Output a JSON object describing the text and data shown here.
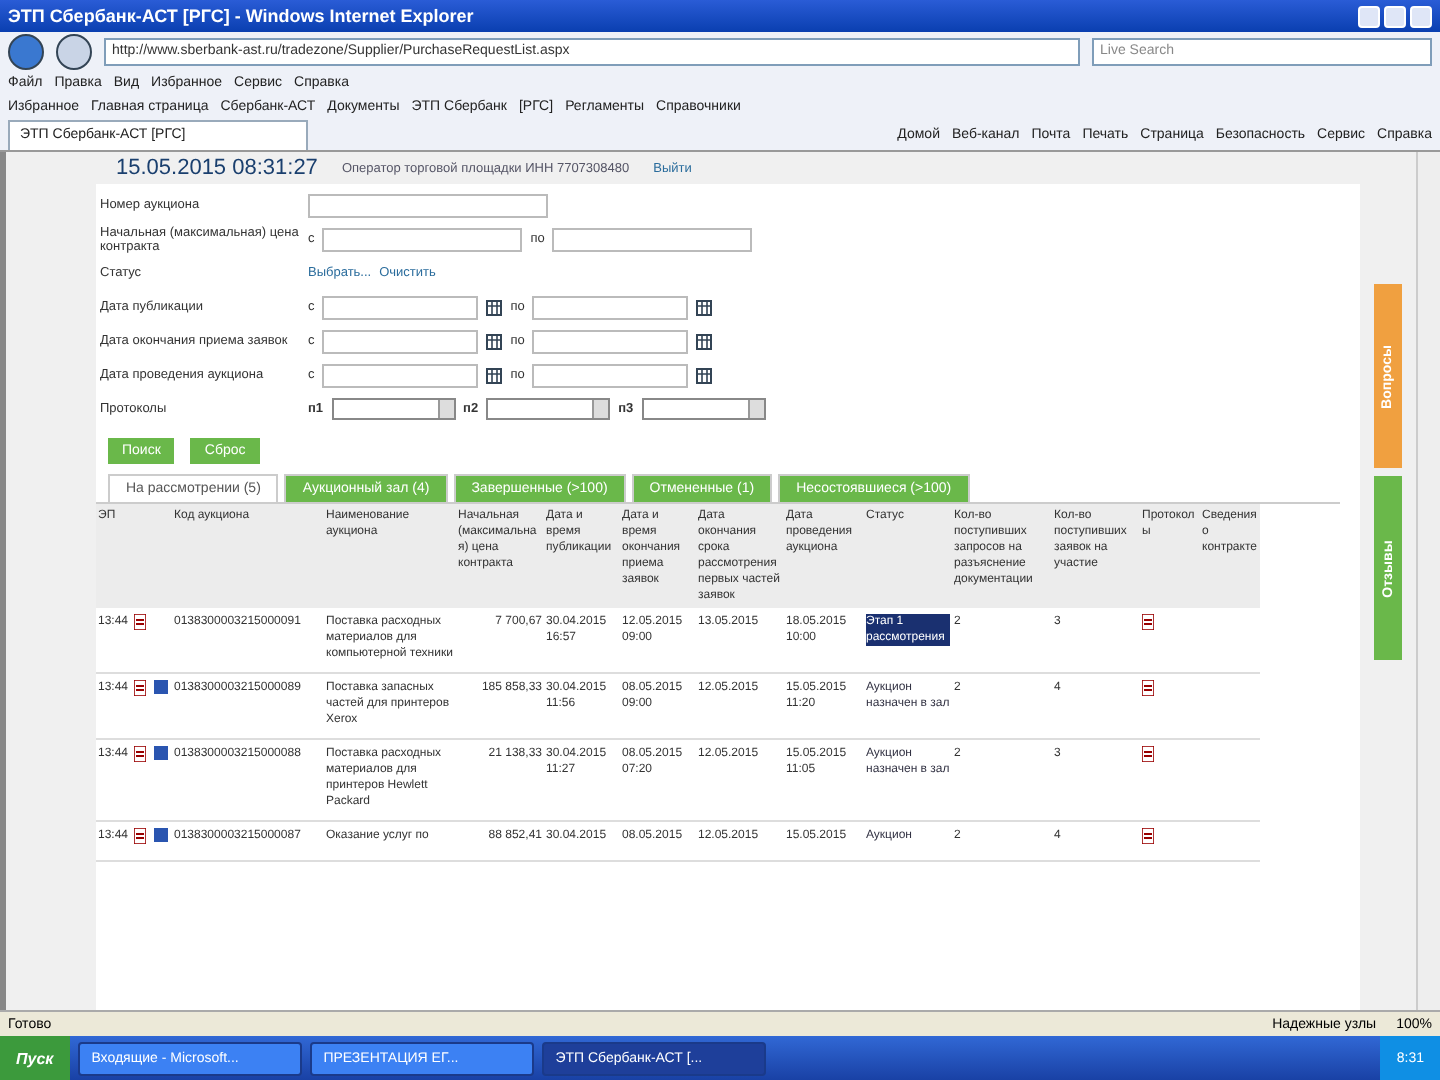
{
  "window": {
    "title": "ЭТП Сбербанк-АСТ [РГС] - Windows Internet Explorer"
  },
  "address": {
    "url": "http://www.sberbank-ast.ru/tradezone/Supplier/PurchaseRequestList.aspx",
    "search_placeholder": "Live Search"
  },
  "menu": [
    "Файл",
    "Правка",
    "Вид",
    "Избранное",
    "Сервис",
    "Справка"
  ],
  "favorites": [
    "Избранное",
    "Главная страница",
    "Сбербанк-АСТ",
    "Документы",
    "ЭТП Сбербанк",
    "[РГС]",
    "Регламенты",
    "Справочники"
  ],
  "browser_tab": {
    "title": "ЭТП Сбербанк-АСТ [РГС]"
  },
  "commands": [
    "Домой",
    "Веб-канал",
    "Почта",
    "Печать",
    "Страница",
    "Безопасность",
    "Сервис",
    "Справка"
  ],
  "header": {
    "datetime": "15.05.2015 08:31:27",
    "user": "Оператор торговой площадки ИНН 7707308480",
    "logout": "Выйти"
  },
  "filters": [
    {
      "kind": "text",
      "label": "Номер аукциона"
    },
    {
      "kind": "range",
      "label": "Начальная (максимальная) цена контракта",
      "from": "с",
      "to": "по"
    },
    {
      "kind": "links",
      "label": "Статус",
      "links": [
        "Выбрать...",
        "Очистить"
      ]
    },
    {
      "kind": "date",
      "label": "Дата публикации",
      "from": "с",
      "to": "по"
    },
    {
      "kind": "date",
      "label": "Дата окончания приема заявок",
      "from": "с",
      "to": "по"
    },
    {
      "kind": "date",
      "label": "Дата проведения аукциона",
      "from": "с",
      "to": "по"
    },
    {
      "kind": "protocols",
      "label": "Протоколы",
      "selects": [
        "п1",
        "п2",
        "п3"
      ]
    }
  ],
  "buttons": [
    "Поиск",
    "Сброс"
  ],
  "tabs": [
    {
      "label": "На рассмотрении (5)",
      "selected": true
    },
    {
      "label": "Аукционный зал (4)",
      "selected": false
    },
    {
      "label": "Завершенные (>100)",
      "selected": false
    },
    {
      "label": "Отмененные (1)",
      "selected": false
    },
    {
      "label": "Несостоявшиеся (>100)",
      "selected": false
    }
  ],
  "table": {
    "columns": [
      "ЭП",
      "Код аукциона",
      "Наименование аукциона",
      "Начальная (максимальная) цена контракта",
      "Дата и время публикации",
      "Дата и время окончания приема заявок",
      "Дата окончания срока рассмотрения первых частей заявок",
      "Дата проведения аукциона",
      "Статус",
      "Кол-во поступивших запросов на разъяснение документации",
      "Кол-во поступивших заявок на участие",
      "Протоколы",
      "Сведения о контракте"
    ],
    "rows": [
      {
        "time": "13:44",
        "info": false,
        "code": "0138300003215000091",
        "name": "Поставка расходных материалов для компьютерной техники",
        "price": "7 700,67",
        "published": "30.04.2015 16:57",
        "apps_end": "12.05.2015 09:00",
        "review_end": "13.05.2015",
        "auction": "18.05.2015 10:00",
        "status": "Этап 1 рассмотрения",
        "status_selected": true,
        "requests": "2",
        "apps": "3"
      },
      {
        "time": "13:44",
        "info": true,
        "code": "0138300003215000089",
        "name": "Поставка запасных частей для принтеров Xerox",
        "price": "185 858,33",
        "published": "30.04.2015 11:56",
        "apps_end": "08.05.2015 09:00",
        "review_end": "12.05.2015",
        "auction": "15.05.2015 11:20",
        "status": "Аукцион назначен в зал",
        "status_selected": false,
        "requests": "2",
        "apps": "4"
      },
      {
        "time": "13:44",
        "info": true,
        "code": "0138300003215000088",
        "name": "Поставка расходных материалов для принтеров Hewlett Packard",
        "price": "21 138,33",
        "published": "30.04.2015 11:27",
        "apps_end": "08.05.2015 07:20",
        "review_end": "12.05.2015",
        "auction": "15.05.2015 11:05",
        "status": "Аукцион назначен в зал",
        "status_selected": false,
        "requests": "2",
        "apps": "3"
      },
      {
        "time": "13:44",
        "info": true,
        "code": "0138300003215000087",
        "name": "Оказание услуг по",
        "price": "88 852,41",
        "published": "30.04.2015",
        "apps_end": "08.05.2015",
        "review_end": "12.05.2015",
        "auction": "15.05.2015",
        "status": "Аукцион",
        "status_selected": false,
        "requests": "2",
        "apps": "4"
      }
    ]
  },
  "side_tabs": [
    "Вопросы",
    "Отзывы"
  ],
  "status_bar": {
    "text": "Готово",
    "zone": "Надежные узлы",
    "zoom": "100%"
  },
  "taskbar": {
    "start": "Пуск",
    "windows": [
      {
        "label": "Входящие - Microsoft...",
        "selected": false
      },
      {
        "label": "ПРЕЗЕНТАЦИЯ ЕГ...",
        "selected": false
      },
      {
        "label": "ЭТП Сбербанк-АСТ [...",
        "selected": true
      }
    ],
    "clock": "8:31"
  }
}
